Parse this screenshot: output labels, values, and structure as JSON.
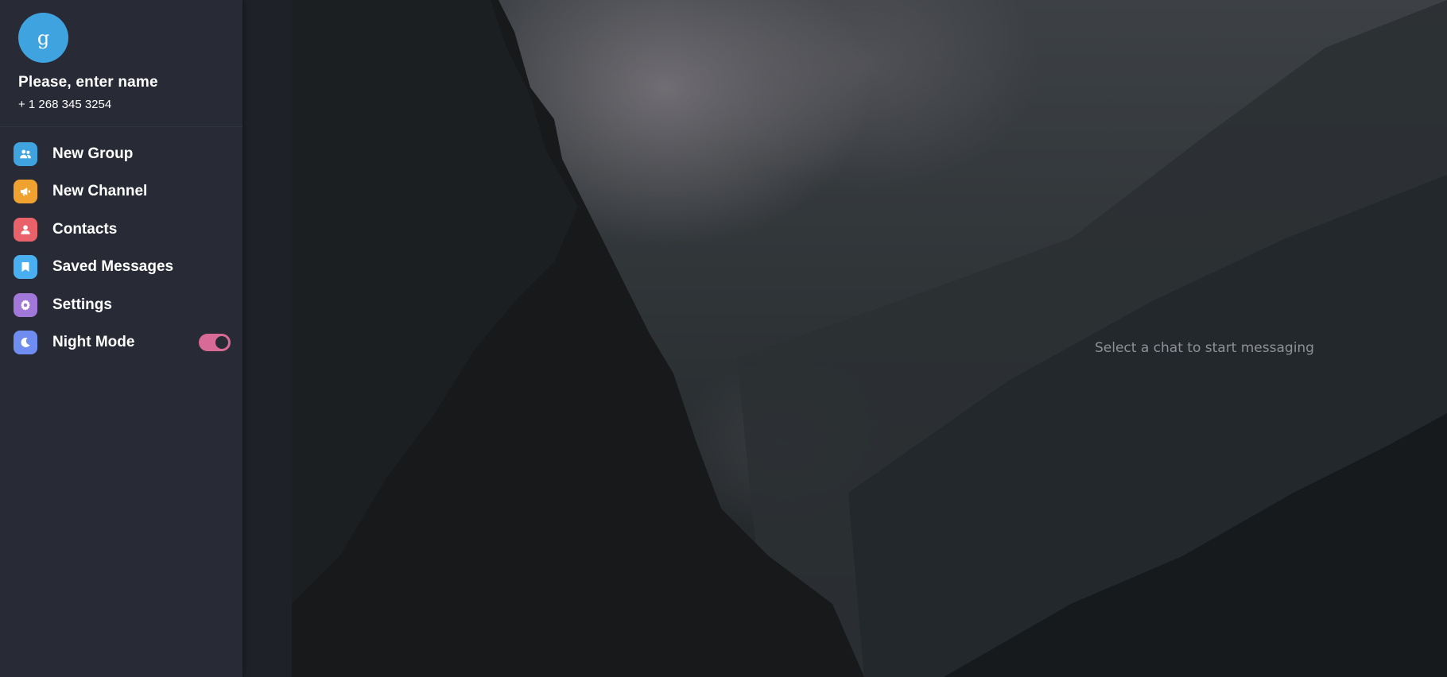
{
  "profile": {
    "avatar_letter": "g",
    "name": "Please, enter name",
    "phone": "+ 1 268 345 3254"
  },
  "menu": {
    "items": [
      {
        "label": "New Group",
        "icon": "group-icon",
        "color": "#3fa3e0"
      },
      {
        "label": "New Channel",
        "icon": "megaphone-icon",
        "color": "#f0a230"
      },
      {
        "label": "Contacts",
        "icon": "person-icon",
        "color": "#e9626a"
      },
      {
        "label": "Saved Messages",
        "icon": "bookmark-icon",
        "color": "#4aaff0"
      },
      {
        "label": "Settings",
        "icon": "gear-icon",
        "color": "#a177d9"
      },
      {
        "label": "Night Mode",
        "icon": "moon-icon",
        "color": "#6f8cf0"
      }
    ],
    "night_mode_enabled": true,
    "toggle_color": "#d86a96"
  },
  "main": {
    "empty_hint": "Select a chat to start messaging"
  }
}
